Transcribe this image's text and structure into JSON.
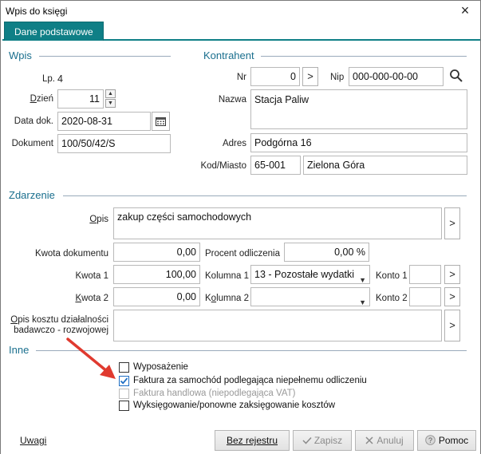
{
  "window": {
    "title": "Wpis do księgi",
    "close_label": "×"
  },
  "tabs": [
    {
      "label": "Dane podstawowe"
    }
  ],
  "sections": {
    "wpis": "Wpis",
    "kontrahent": "Kontrahent",
    "zdarzenie": "Zdarzenie",
    "inne": "Inne"
  },
  "wpis": {
    "lp_label": "Lp.",
    "lp_value": "4",
    "dzien_label": "Dzień",
    "dzien_value": "11",
    "data_label": "Data dok.",
    "data_value": "2020-08-31",
    "dokument_label": "Dokument",
    "dokument_value": "100/50/42/S"
  },
  "kontrahent": {
    "nr_label": "Nr",
    "nr_value": "0",
    "nr_btn": ">",
    "nip_label": "Nip",
    "nip_value": "000-000-00-00",
    "nazwa_label": "Nazwa",
    "nazwa_value": "Stacja Paliw",
    "adres_label": "Adres",
    "adres_value": "Podgórna 16",
    "kodmiasto_label": "Kod/Miasto",
    "kod_value": "65-001",
    "miasto_value": "Zielona Góra"
  },
  "zdarzenie": {
    "opis_label": "Opis",
    "opis_value": "zakup części samochodowych",
    "kwota_dok_label": "Kwota dokumentu",
    "kwota_dok_value": "0,00",
    "procent_label": "Procent odliczenia",
    "procent_value": "0,00 %",
    "kwota1_label": "Kwota 1",
    "kwota1_value": "100,00",
    "kolumna1_label": "Kolumna 1",
    "kolumna1_value": "13 - Pozostałe wydatki",
    "konto1_label": "Konto 1",
    "konto1_value": "",
    "kwota2_label": "Kwota 2",
    "kwota2_value": "0,00",
    "kolumna2_label": "Kolumna 2",
    "kolumna2_value": "",
    "konto2_label": "Konto 2",
    "konto2_value": "",
    "opis_kosztu_label_1": "Opis kosztu działalności",
    "opis_kosztu_label_2": "badawczo - rozwojowej",
    "opis_kosztu_value": "",
    "more_btn": ">"
  },
  "inne": {
    "wyposazenie": {
      "label": "Wyposażenie",
      "checked": false,
      "enabled": true
    },
    "faktura_samochod": {
      "label": "Faktura za samochód podlegająca niepełnemu odliczeniu",
      "checked": true,
      "enabled": true
    },
    "faktura_handlowa": {
      "label": "Faktura handlowa (niepodlegająca VAT)",
      "checked": false,
      "enabled": false
    },
    "wyksiegowanie": {
      "label": "Wyksięgowanie/ponowne zaksięgowanie kosztów",
      "checked": false,
      "enabled": true
    }
  },
  "footer": {
    "uwagi": "Uwagi",
    "bez_rejestru": "Bez rejestru",
    "zapisz": "Zapisz",
    "anuluj": "Anuluj",
    "pomoc": "Pomoc"
  },
  "colors": {
    "accent": "#0f7f86",
    "section": "#1a6f8e",
    "arrow": "#e03a2f",
    "check": "#1f6fc4"
  },
  "icons": {
    "search": "search-icon",
    "calendar": "calendar-icon",
    "check": "check-icon",
    "cancel": "x-icon",
    "help": "help-icon",
    "annotation": "red-arrow"
  }
}
